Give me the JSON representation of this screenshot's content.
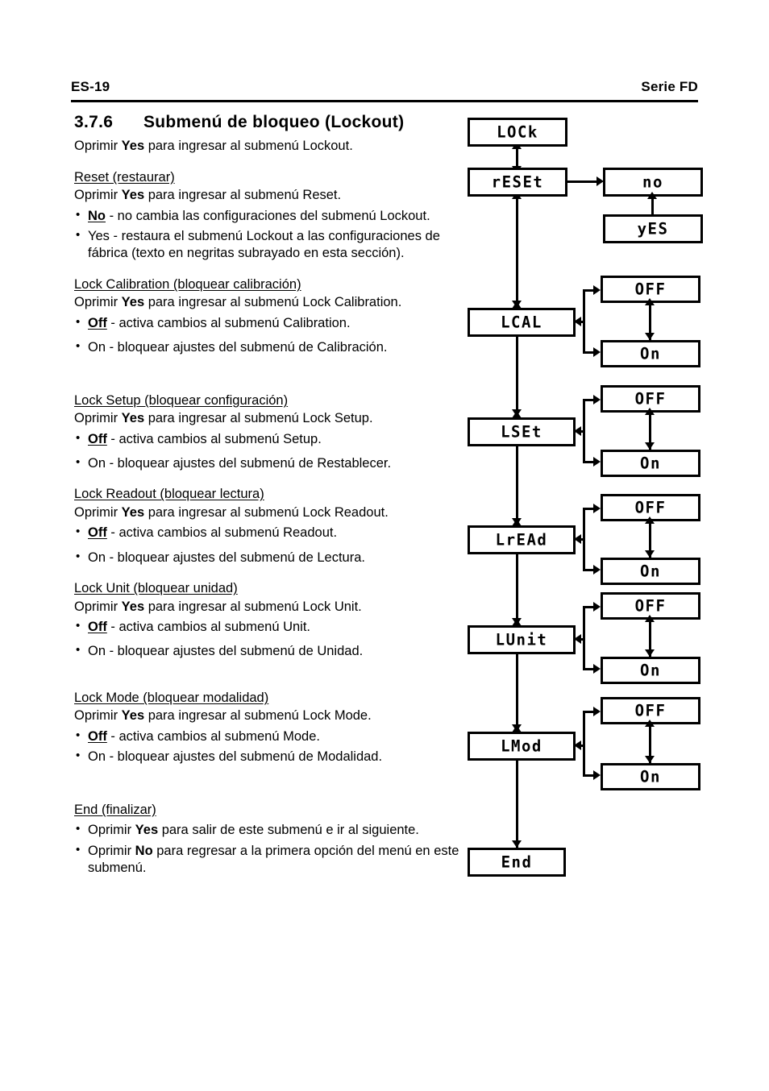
{
  "header": {
    "page_id": "ES-19",
    "series": "Serie FD"
  },
  "section": {
    "number": "3.7.6",
    "title": "Submenú de bloqueo (Lockout)",
    "intro_prefix": "Oprimir ",
    "intro_bold": "Yes",
    "intro_suffix": " para ingresar al submenú Lockout."
  },
  "blocks": [
    {
      "heading": "Reset (restaurar)",
      "press_prefix": "Oprimir ",
      "press_bold": "Yes",
      "press_suffix": " para ingresar al submenú Reset.",
      "bullets": [
        {
          "bold_underline": "No",
          "text": " - no cambia las configuraciones del submenú Lockout."
        },
        {
          "bold_underline": "",
          "text": "Yes - restaura el submenú Lockout a las configuraciones de fábrica (texto en negritas subrayado en esta sección)."
        }
      ]
    },
    {
      "heading": "Lock Calibration (bloquear calibración)",
      "press_prefix": "Oprimir ",
      "press_bold": "Yes",
      "press_suffix": " para ingresar al submenú Lock Calibration.",
      "bullets": [
        {
          "bold_underline": "Off",
          "text": " - activa cambios al submenú Calibration."
        },
        {
          "bold_underline": "",
          "text": "On - bloquear ajustes del submenú de Calibración."
        }
      ]
    },
    {
      "heading": "Lock Setup (bloquear configuración)",
      "press_prefix": "Oprimir ",
      "press_bold": "Yes",
      "press_suffix": " para ingresar al submenú Lock Setup.",
      "bullets": [
        {
          "bold_underline": "Off",
          "text": " - activa cambios al submenú Setup."
        },
        {
          "bold_underline": "",
          "text": "On - bloquear ajustes del submenú de Restablecer."
        }
      ]
    },
    {
      "heading": "Lock Readout (bloquear lectura)",
      "press_prefix": "Oprimir ",
      "press_bold": "Yes",
      "press_suffix": " para ingresar al submenú Lock Readout.",
      "bullets": [
        {
          "bold_underline": "Off",
          "text": " - activa cambios al submenú Readout."
        },
        {
          "bold_underline": "",
          "text": "On - bloquear ajustes del submenú de Lectura."
        }
      ]
    },
    {
      "heading": "Lock Unit (bloquear unidad)",
      "press_prefix": "Oprimir ",
      "press_bold": "Yes",
      "press_suffix": " para ingresar al submenú Lock Unit.",
      "bullets": [
        {
          "bold_underline": "Off",
          "text": " - activa cambios al submenú Unit."
        },
        {
          "bold_underline": "",
          "text": "On - bloquear ajustes del submenú de Unidad."
        }
      ]
    },
    {
      "heading": "Lock Mode (bloquear modalidad)",
      "press_prefix": "Oprimir ",
      "press_bold": "Yes",
      "press_suffix": " para ingresar al submenú Lock Mode.",
      "bullets": [
        {
          "bold_underline": "Off",
          "text": " - activa cambios al submenú Mode."
        },
        {
          "bold_underline": "",
          "text": "On - bloquear ajustes del submenú de Modalidad."
        }
      ]
    }
  ],
  "end_block": {
    "heading": "End (finalizar)",
    "bullets": [
      {
        "pre": "Oprimir ",
        "bold": "Yes",
        "post": " para salir de este submenú e ir al siguiente."
      },
      {
        "pre": "Oprimir ",
        "bold": "No",
        "post": " para regresar a la primera opción del menú en este submenú."
      }
    ]
  },
  "flowchart": {
    "type": "menu-tree",
    "display_style": "7-segment-lcd",
    "nodes": {
      "lock": "LOCk",
      "reset": "rESEt",
      "reset_no": "no",
      "reset_yes": "yES",
      "lcal": "LCAL",
      "lcal_off": "OFF",
      "lcal_on": "On",
      "lset": "LSEt",
      "lset_off": "OFF",
      "lset_on": "On",
      "lread": "LrEAd",
      "lread_off": "OFF",
      "lread_on": "On",
      "lunit": "LUnit",
      "lunit_off": "OFF",
      "lunit_on": "On",
      "lmod": "LMod",
      "lmod_off": "OFF",
      "lmod_on": "On",
      "end": "End"
    }
  }
}
